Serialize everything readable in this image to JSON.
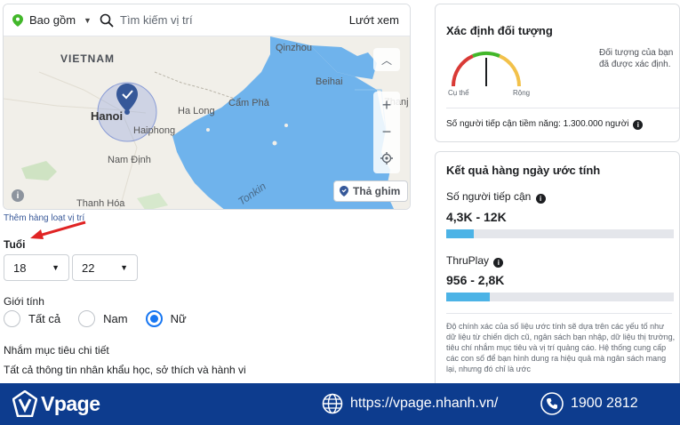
{
  "location": {
    "filter_label": "Bao gồm",
    "search_placeholder": "Tìm kiếm vị trí",
    "browse_label": "Lướt xem",
    "drop_pin_label": "Thả ghim",
    "add_bulk_link": "Thêm hàng loạt vị trí",
    "map_labels": {
      "vietnam": "VIETNAM",
      "qinzhou": "Qinzhou",
      "beihai": "Beihai",
      "zhanjiang": "Zhanj",
      "hanoi": "Hanoi",
      "halong": "Ha Long",
      "campha": "Cẩm Phả",
      "haiphong": "Haiphong",
      "namdinh": "Nam Định",
      "thanhhoa": "Thanh Hóa",
      "tonkin": "Tonkin"
    }
  },
  "age": {
    "label": "Tuổi",
    "min": "18",
    "max": "22"
  },
  "gender": {
    "label": "Giới tính",
    "options": [
      "Tất cả",
      "Nam",
      "Nữ"
    ],
    "selected": "Nữ"
  },
  "detailed_targeting": {
    "label": "Nhắm mục tiêu chi tiết",
    "description": "Tất cả thông tin nhân khẩu học, sở thích và hành vi"
  },
  "audience_definition": {
    "title": "Xác định đối tượng",
    "gauge_left": "Cụ thể",
    "gauge_right": "Rộng",
    "gauge_level": 0.5,
    "note": "Đối tượng của bạn đã được xác định.",
    "potential_reach": "Số người tiếp cận tiềm năng: 1.300.000 người"
  },
  "daily_results": {
    "title": "Kết quả hàng ngày ước tính",
    "reach_label": "Số người tiếp cận",
    "reach_value": "4,3K - 12K",
    "reach_fill": 0.12,
    "thruplay_label": "ThruPlay",
    "thruplay_value": "956 - 2,8K",
    "thruplay_fill": 0.19,
    "disclaimer": "Độ chính xác của số liệu ước tính sẽ dựa trên các yếu tố như dữ liệu từ chiến dịch cũ, ngân sách bạn nhập, dữ liệu thị trường, tiêu chí nhắm mục tiêu và vị trí quảng cáo. Hệ thống cung cấp các con số để bạn hình dung ra hiệu quả mà ngân sách mang lại, nhưng đó chỉ là ước"
  },
  "footer": {
    "brand": "Vpage",
    "url": "https://vpage.nhanh.vn/",
    "phone": "1900 2812"
  },
  "colors": {
    "accent": "#1877f2",
    "bar": "#4cb3e6",
    "footer_bg": "#0d3c8e",
    "sea": "#6fb3ec",
    "arrow": "#e02424"
  }
}
